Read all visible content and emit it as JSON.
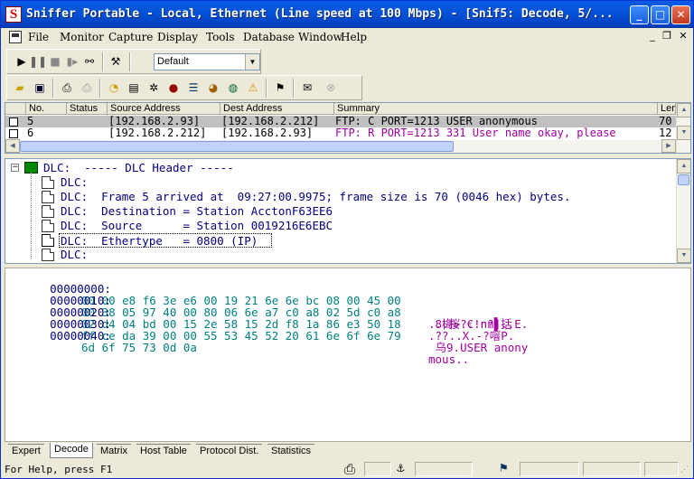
{
  "window": {
    "title": "Sniffer Portable - Local, Ethernet (Line speed at 100 Mbps) - [Snif5: Decode, 5/...",
    "app_icon": "S"
  },
  "menu": [
    "File",
    "Monitor",
    "Capture",
    "Display",
    "Tools",
    "Database",
    "Window",
    "Help"
  ],
  "toolbar1": {
    "profile": "Default"
  },
  "packet_list": {
    "columns": [
      "No.",
      "Status",
      "Source Address",
      "Dest Address",
      "Summary",
      "Len"
    ],
    "rows": [
      {
        "no": "5",
        "status": "",
        "src": "[192.168.2.93]",
        "dst": "[192.168.2.212]",
        "summary": "FTP: C PORT=1213    USER anonymous",
        "len": "70",
        "selected": true
      },
      {
        "no": "6",
        "status": "",
        "src": "[192.168.2.212]",
        "dst": "[192.168.2.93]",
        "summary": "FTP: R PORT=1213    331 User name okay, please",
        "len": "12",
        "selected": false
      }
    ]
  },
  "decode": {
    "header": "DLC:  ----- DLC Header -----",
    "lines": [
      "DLC:",
      "DLC:  Frame 5 arrived at  09:27:00.9975; frame size is 70 (0046 hex) bytes.",
      "DLC:  Destination = Station AcctonF63EE6",
      "DLC:  Source      = Station 0019216E6EBC",
      "DLC:  Ethertype   = 0800 (IP)",
      "DLC:"
    ],
    "selected_index": 4
  },
  "hex": [
    {
      "offset": "00000000:",
      "bytes": "00 00 e8 f6 3e e6 00 19 21 6e 6e bc 08 00 45 00",
      "ascii": "..梅>?.!nn▌..E."
    },
    {
      "offset": "00000010:",
      "bytes": "00 38 05 97 40 00 80 06 6e a7 c0 a8 02 5d c0 a8",
      "ascii": ".8.桜.€.n?]括"
    },
    {
      "offset": "00000020:",
      "bytes": "02 d4 04 bd 00 15 2e 58 15 2d f8 1a 86 e3 50 18",
      "ascii": ".??..X.-?噾P."
    },
    {
      "offset": "00000030:",
      "bytes": "ff ce da 39 00 00 55 53 45 52 20 61 6e 6f 6e 79",
      "ascii": " 乌9.USER anony"
    },
    {
      "offset": "00000040:",
      "bytes": "6d 6f 75 73 0d 0a",
      "ascii": "mous.."
    }
  ],
  "tabs": [
    "Expert",
    "Decode",
    "Matrix",
    "Host Table",
    "Protocol Dist.",
    "Statistics"
  ],
  "active_tab": "Decode",
  "status": {
    "help": "For Help, press F1"
  }
}
